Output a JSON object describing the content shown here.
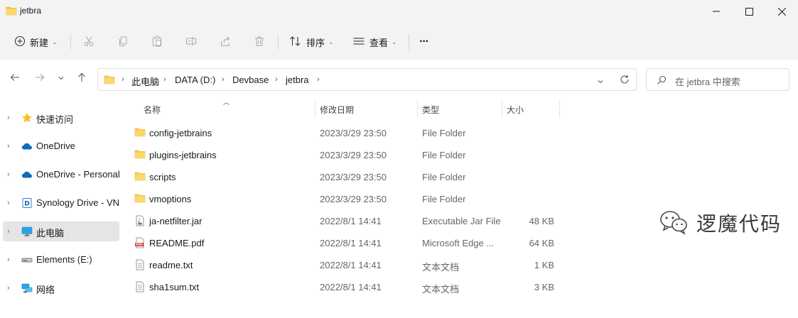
{
  "window": {
    "title": "jetbra"
  },
  "toolbar": {
    "new_label": "新建",
    "sort_label": "排序",
    "view_label": "查看",
    "more_label": "···"
  },
  "address": {
    "crumbs": [
      "此电脑",
      "DATA (D:)",
      "Devbase",
      "jetbra"
    ]
  },
  "search": {
    "placeholder": "在 jetbra 中搜索"
  },
  "sidebar": {
    "items": [
      {
        "label": "快速访问",
        "icon": "star-icon"
      },
      {
        "label": "OneDrive",
        "icon": "cloud-icon"
      },
      {
        "label": "OneDrive - Personal",
        "icon": "cloud-icon"
      },
      {
        "label": "Synology Drive - VN",
        "icon": "synology-icon"
      },
      {
        "label": "此电脑",
        "icon": "monitor-icon",
        "selected": true
      },
      {
        "label": "Elements (E:)",
        "icon": "drive-icon"
      },
      {
        "label": "网络",
        "icon": "network-icon"
      }
    ]
  },
  "filelist": {
    "columns": {
      "name": "名称",
      "date": "修改日期",
      "type": "类型",
      "size": "大小"
    },
    "rows": [
      {
        "name": "config-jetbrains",
        "date": "2023/3/29 23:50",
        "type": "File Folder",
        "size": "",
        "icon": "folder-icon"
      },
      {
        "name": "plugins-jetbrains",
        "date": "2023/3/29 23:50",
        "type": "File Folder",
        "size": "",
        "icon": "folder-icon"
      },
      {
        "name": "scripts",
        "date": "2023/3/29 23:50",
        "type": "File Folder",
        "size": "",
        "icon": "folder-icon"
      },
      {
        "name": "vmoptions",
        "date": "2023/3/29 23:50",
        "type": "File Folder",
        "size": "",
        "icon": "folder-icon"
      },
      {
        "name": "ja-netfilter.jar",
        "date": "2022/8/1 14:41",
        "type": "Executable Jar File",
        "size": "48 KB",
        "icon": "jar-file-icon"
      },
      {
        "name": "README.pdf",
        "date": "2022/8/1 14:41",
        "type": "Microsoft Edge ...",
        "size": "64 KB",
        "icon": "pdf-file-icon"
      },
      {
        "name": "readme.txt",
        "date": "2022/8/1 14:41",
        "type": "文本文档",
        "size": "1 KB",
        "icon": "text-file-icon"
      },
      {
        "name": "sha1sum.txt",
        "date": "2022/8/1 14:41",
        "type": "文本文档",
        "size": "3 KB",
        "icon": "text-file-icon"
      }
    ]
  },
  "watermark": {
    "text": "逻魔代码"
  },
  "colors": {
    "folder": "#f8c94a",
    "selection": "#e5e5e5",
    "accent": "#0067c0"
  }
}
